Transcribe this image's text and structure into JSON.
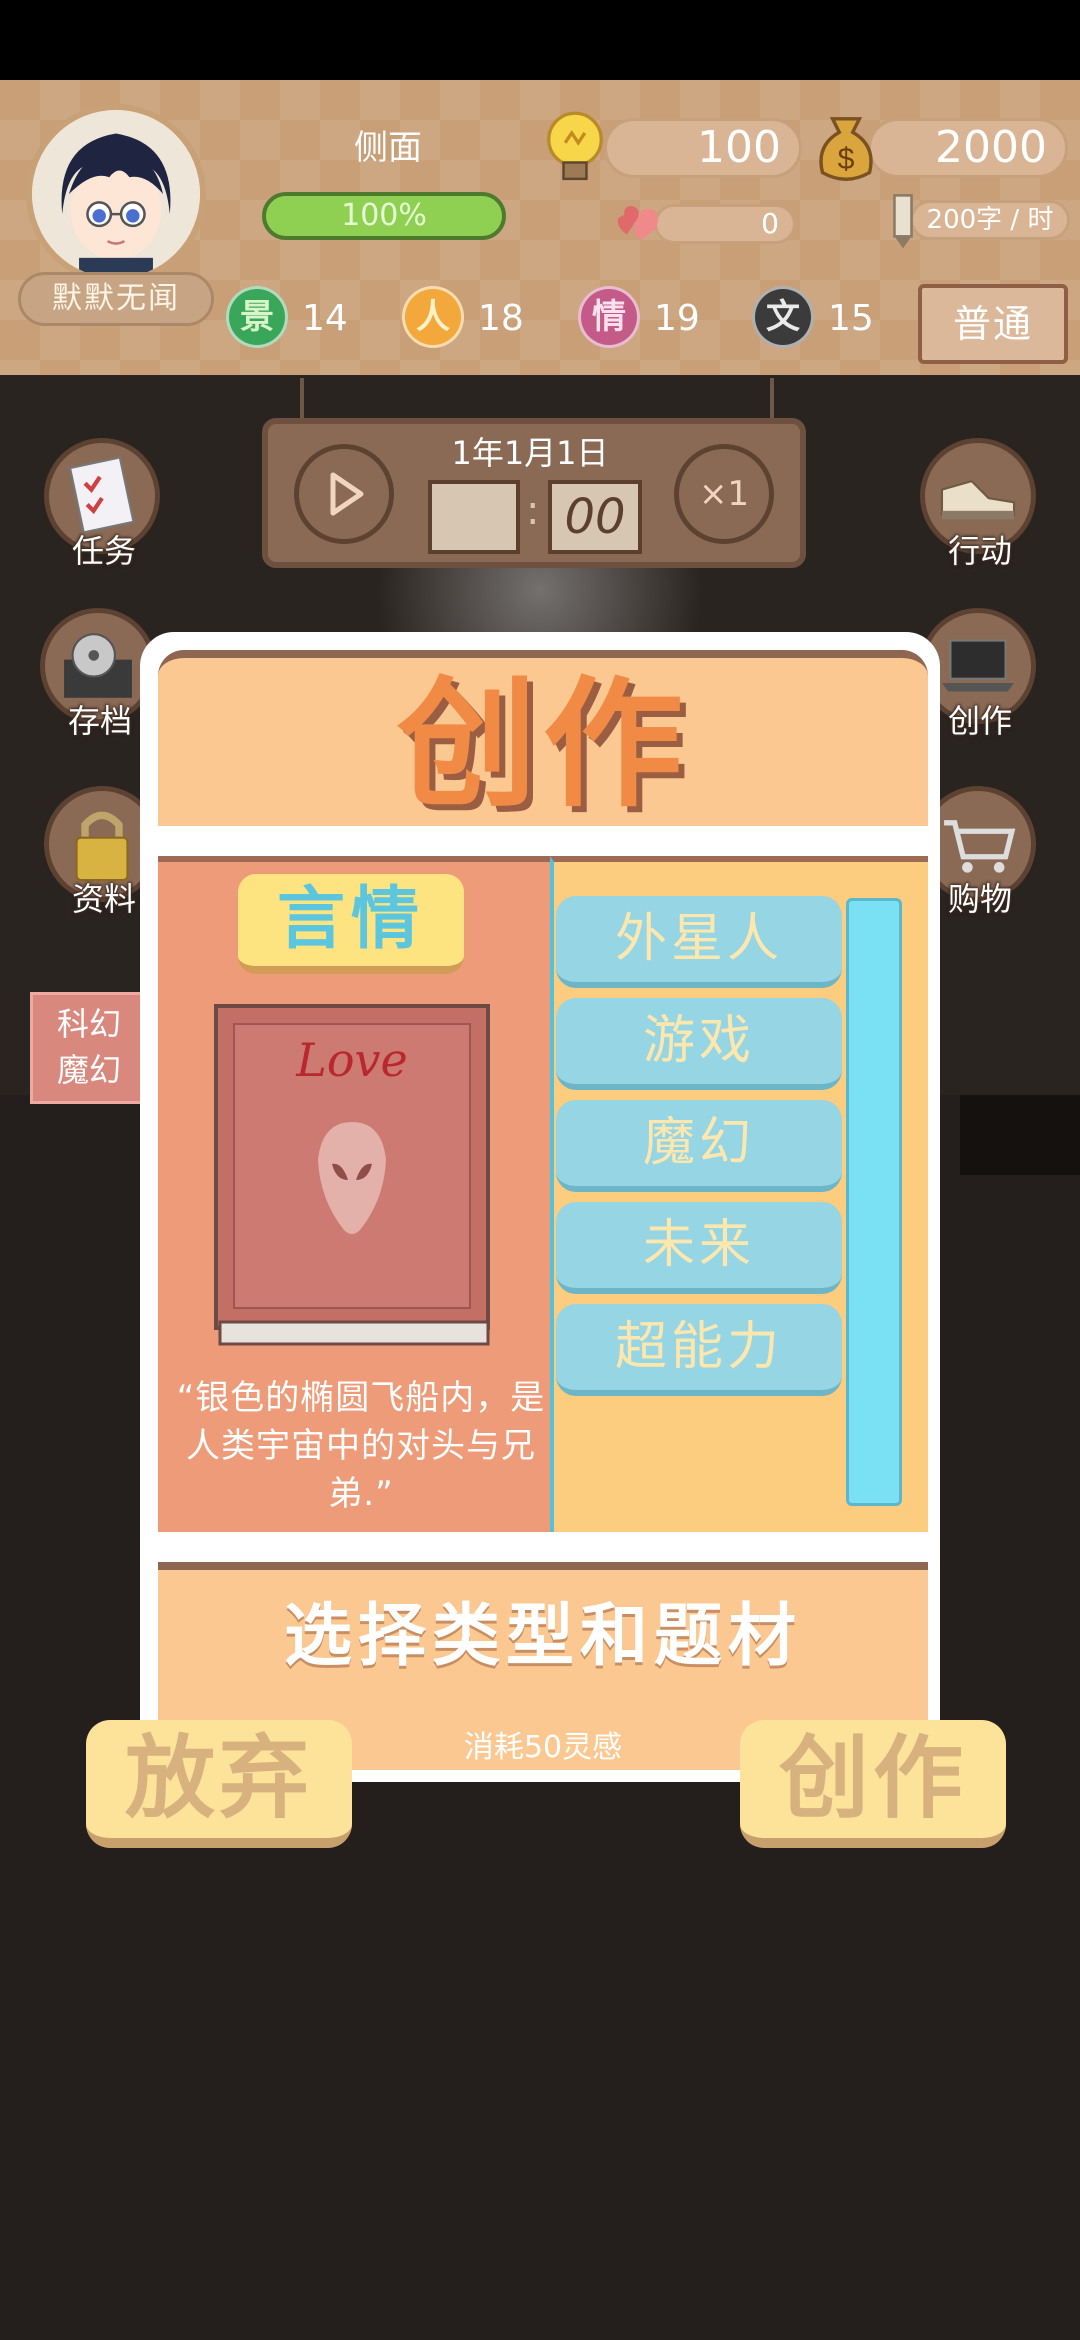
{
  "hud": {
    "player_name": "默默无闻",
    "view_label": "侧面",
    "progress_percent": 100,
    "progress_text": "100%",
    "inspiration": "100",
    "money": "2000",
    "hearts": "0",
    "word_rate": "200字 / 时",
    "stats": [
      {
        "glyph": "景",
        "value": "14",
        "color": "#3aa65a"
      },
      {
        "glyph": "人",
        "value": "18",
        "color": "#f3a83b"
      },
      {
        "glyph": "情",
        "value": "19",
        "color": "#c45a87"
      },
      {
        "glyph": "文",
        "value": "15",
        "color": "#3b3b3b"
      }
    ],
    "mode_label": "普通"
  },
  "clock": {
    "date": "1年1月1日",
    "minute": "00",
    "speed": "×1"
  },
  "side_menu": {
    "tasks": "任务",
    "save": "存档",
    "data": "资料",
    "action": "行动",
    "create": "创作",
    "shop": "购物"
  },
  "genre_tag": {
    "line1": "科幻",
    "line2": "魔幻"
  },
  "modal": {
    "title": "创作",
    "genre": "言情",
    "book_cover_text": "Love",
    "quote": "“银色的椭圆飞船内，是人类宇宙中的对头与兄弟.”",
    "topics": [
      "外星人",
      "游戏",
      "魔幻",
      "未来",
      "超能力"
    ],
    "prompt": "选择类型和题材",
    "cost": "消耗50灵感"
  },
  "buttons": {
    "cancel": "放弃",
    "create": "创作"
  },
  "colors": {
    "accent_orange": "#f08a45",
    "topic_blue": "#96d5e4",
    "button_yellow": "#fde29a"
  }
}
